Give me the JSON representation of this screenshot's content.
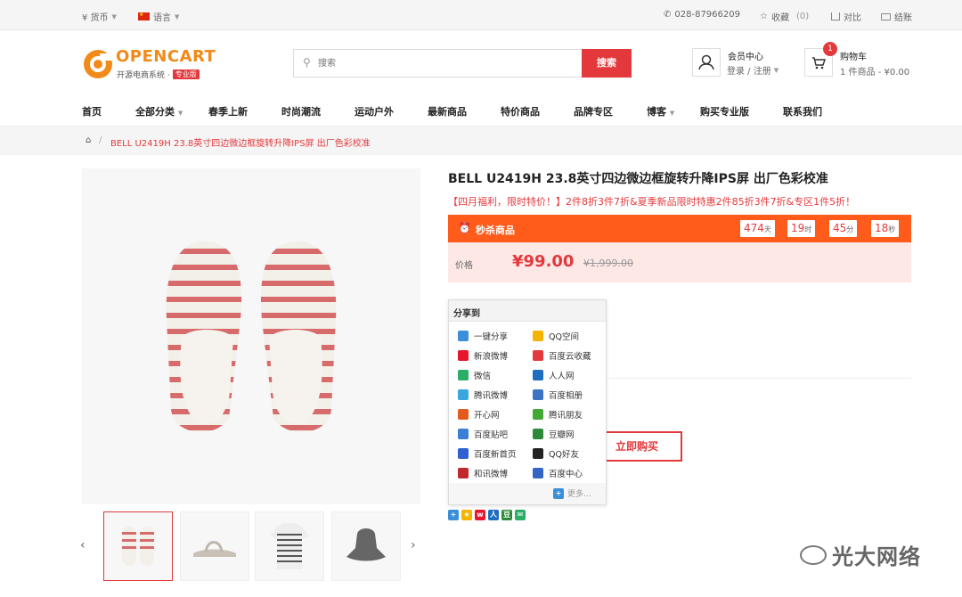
{
  "topbar": {
    "currency": "¥ 货币",
    "language": "语言",
    "phone": "028-87966209",
    "favorites": "收藏",
    "favorites_count": "(0)",
    "compare": "对比",
    "checkout": "结账"
  },
  "header": {
    "logo_text": "OPENCART",
    "logo_sub": "开源电商系统 ·",
    "logo_badge": "专业版",
    "search_placeholder": "搜索",
    "search_button": "搜索",
    "member_title": "会员中心",
    "member_links": "登录 / 注册",
    "cart_badge": "1",
    "cart_title": "购物车",
    "cart_summary": "1 件商品 - ¥0.00"
  },
  "nav": {
    "items": [
      "首页",
      "全部分类",
      "春季上新",
      "时尚潮流",
      "运动户外",
      "最新商品",
      "特价商品",
      "品牌专区",
      "博客",
      "购买专业版",
      "联系我们"
    ]
  },
  "breadcrumb": {
    "current": "BELL U2419H 23.8英寸四边微边框旋转升降IPS屏 出厂色彩校准"
  },
  "product": {
    "title": "BELL U2419H 23.8英寸四边微边框旋转升降IPS屏 出厂色彩校准",
    "promo": "【四月福利，限时特价！】2件8折3件7折&夏季新品限时特惠2件85折3件7折&专区1件5折！",
    "flash_label": "秒杀商品",
    "countdown": {
      "days": "474",
      "days_unit": "天",
      "hours": "19",
      "hours_unit": "时",
      "minutes": "45",
      "minutes_unit": "分",
      "seconds": "18",
      "seconds_unit": "秒"
    },
    "price_label": "价格",
    "price": "¥99.00",
    "old_price": "¥1,999.00",
    "buy_button": "立即购买"
  },
  "share": {
    "title": "分享到",
    "items": [
      {
        "label": "一键分享",
        "icon": "one-click-share-icon",
        "color": "#3b8fd9"
      },
      {
        "label": "QQ空间",
        "icon": "qzone-icon",
        "color": "#f4b400"
      },
      {
        "label": "新浪微博",
        "icon": "weibo-icon",
        "color": "#e6162d"
      },
      {
        "label": "百度云收藏",
        "icon": "heart-icon",
        "color": "#e4393c"
      },
      {
        "label": "微信",
        "icon": "wechat-icon",
        "color": "#2aae67"
      },
      {
        "label": "人人网",
        "icon": "renren-icon",
        "color": "#1f6dbf"
      },
      {
        "label": "腾讯微博",
        "icon": "tencent-weibo-icon",
        "color": "#3aa6dd"
      },
      {
        "label": "百度相册",
        "icon": "album-icon",
        "color": "#3b74c4"
      },
      {
        "label": "开心网",
        "icon": "kaixin-icon",
        "color": "#e25a1c"
      },
      {
        "label": "腾讯朋友",
        "icon": "clover-icon",
        "color": "#44a934"
      },
      {
        "label": "百度贴吧",
        "icon": "tieba-icon",
        "color": "#3a7fd6"
      },
      {
        "label": "豆瓣网",
        "icon": "douban-icon",
        "color": "#2d8a3b"
      },
      {
        "label": "百度新首页",
        "icon": "baidu-paw-icon",
        "color": "#2f5fd0"
      },
      {
        "label": "QQ好友",
        "icon": "qq-icon",
        "color": "#222222"
      },
      {
        "label": "和讯微博",
        "icon": "hexun-icon",
        "color": "#c0282d"
      },
      {
        "label": "百度中心",
        "icon": "baidu-center-icon",
        "color": "#3565c4"
      }
    ],
    "more": "更多..."
  },
  "watermark": "光大网络",
  "colors": {
    "accent": "#e4393c",
    "flash_bar": "#ff5c1c",
    "price_bg": "#fde8e6"
  }
}
